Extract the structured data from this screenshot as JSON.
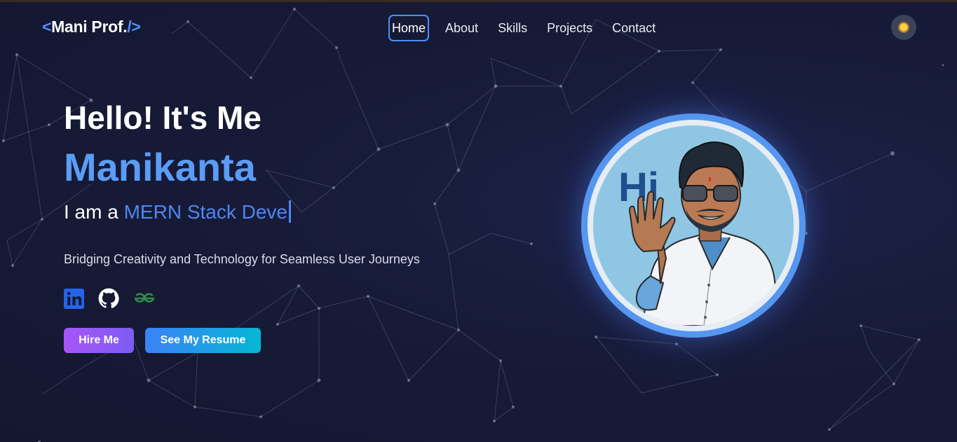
{
  "header": {
    "logo": {
      "open": "<",
      "text": "Mani Prof.",
      "close": "/>"
    },
    "nav": [
      {
        "label": "Home",
        "active": true
      },
      {
        "label": "About",
        "active": false
      },
      {
        "label": "Skills",
        "active": false
      },
      {
        "label": "Projects",
        "active": false
      },
      {
        "label": "Contact",
        "active": false
      }
    ],
    "theme_toggle_icon": "sun-icon"
  },
  "hero": {
    "greeting": "Hello! It's Me",
    "name": "Manikanta",
    "role_prefix": "I am a ",
    "role_typed": "MERN Stack Deve",
    "tagline": "Bridging Creativity and Technology for Seamless User Journeys",
    "social": [
      {
        "icon": "linkedin-icon",
        "color": "#2563eb"
      },
      {
        "icon": "github-icon",
        "color": "#ffffff"
      },
      {
        "icon": "geeksforgeeks-icon",
        "color": "#2f8d46"
      }
    ],
    "buttons": {
      "hire": "Hire Me",
      "resume": "See My Resume"
    },
    "avatar_text": "Hi"
  },
  "colors": {
    "background": "#161a33",
    "accent": "#5b9cf6",
    "typed": "#4f86f0",
    "hire_gradient": [
      "#a855f7",
      "#7c5cf2"
    ],
    "resume_gradient": [
      "#3b82f6",
      "#06b6d4"
    ]
  }
}
